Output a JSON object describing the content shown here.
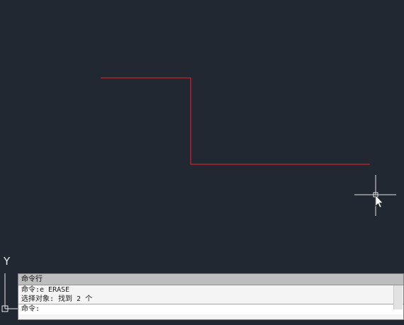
{
  "drawing": {
    "line_color": "#c8202a",
    "cursor_color": "#e0e0e0",
    "background": "#222831"
  },
  "ucs": {
    "y_label": "Y",
    "icon": "ucs-axis-icon"
  },
  "command_line": {
    "title": "命令行",
    "history": [
      "命令:e ERASE",
      "选择对象: 找到 2 个"
    ],
    "prompt": "命令:",
    "input_value": ""
  }
}
